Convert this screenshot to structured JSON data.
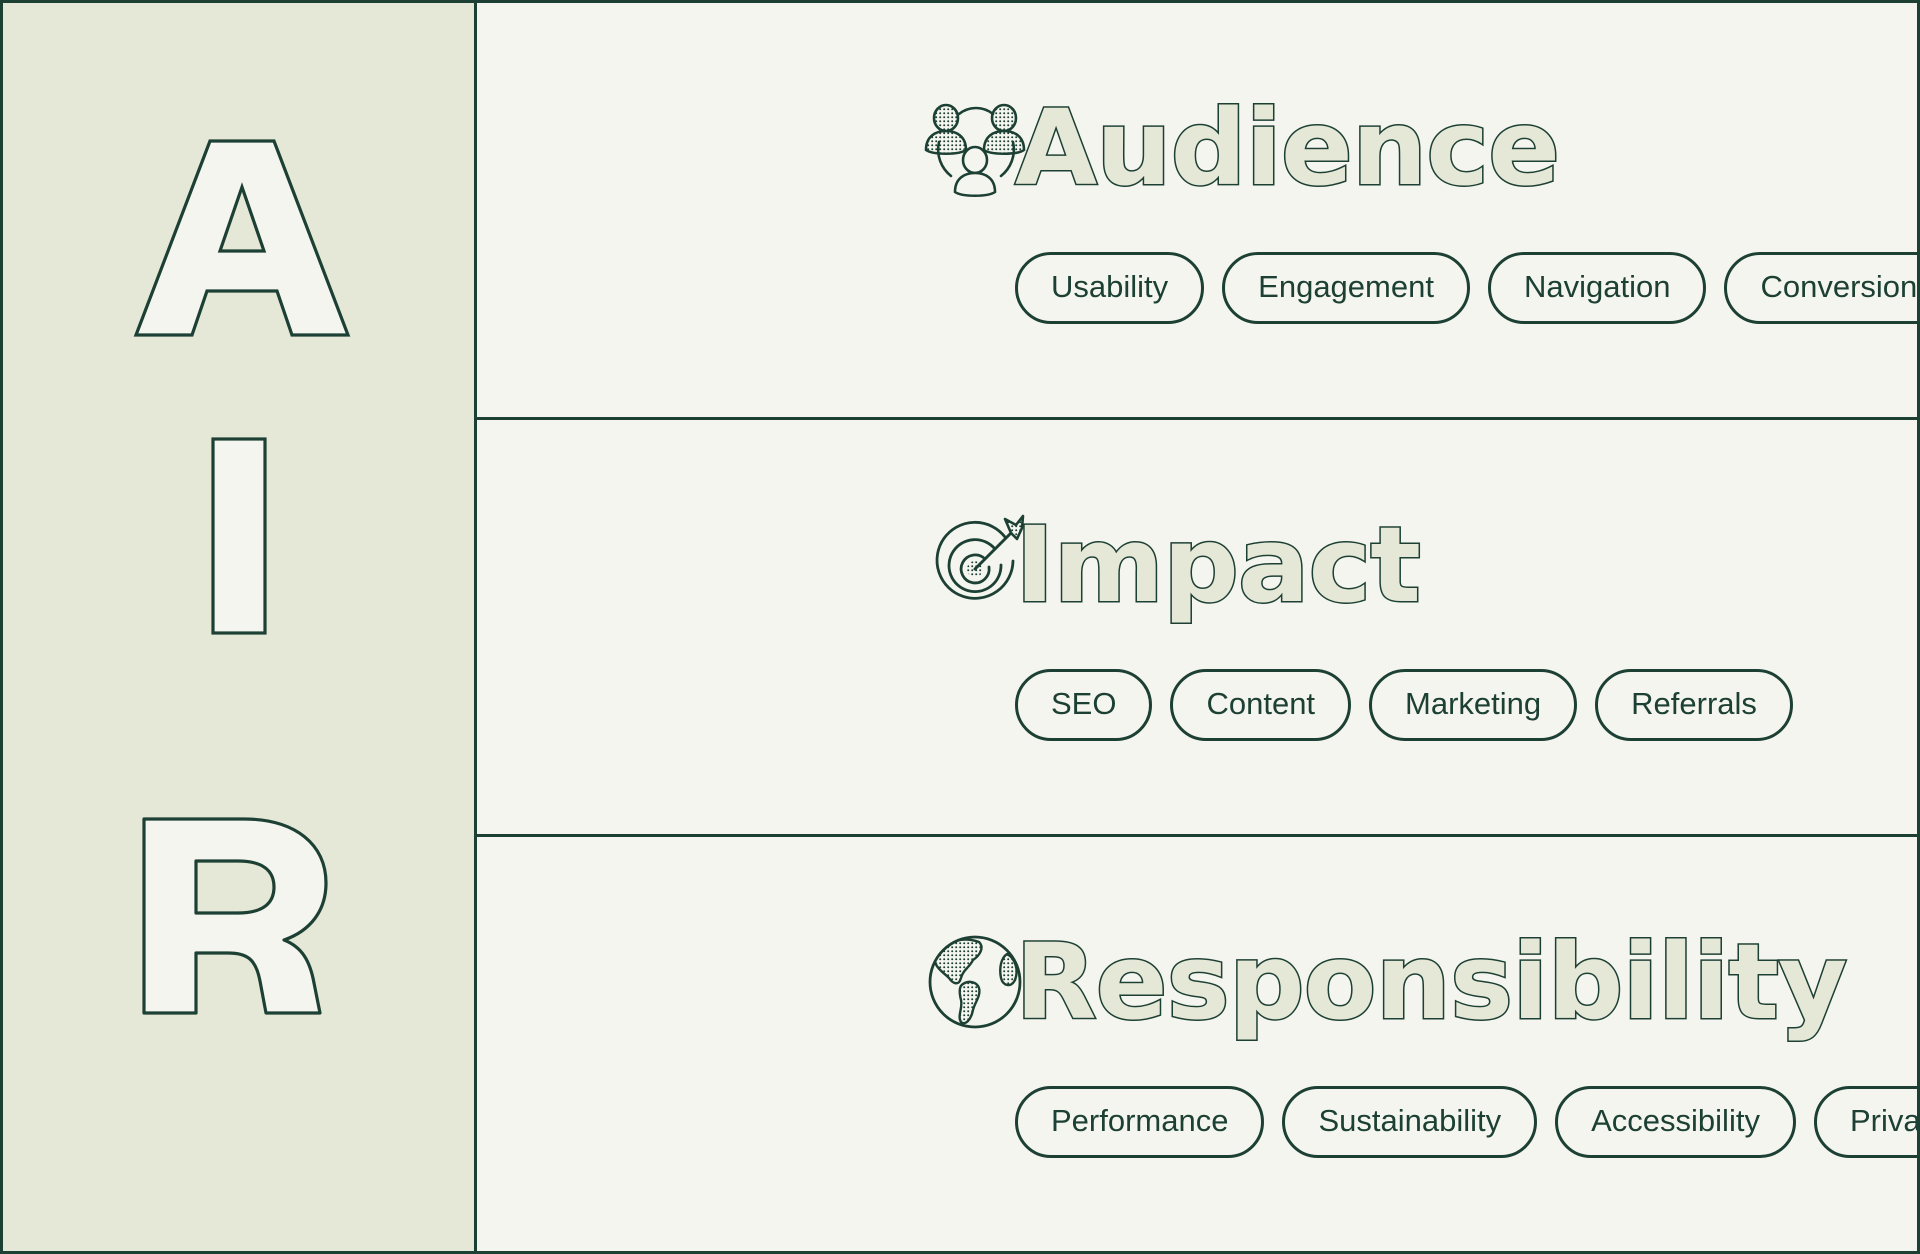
{
  "colors": {
    "sidebar_bg": "#e6e8d7",
    "panel_bg": "#f5f5ef",
    "ink": "#1d4034",
    "letter_fill": "#f5f5ef",
    "title_fill": "#e6e8d7"
  },
  "sidebar": {
    "acronym": "AIR",
    "letters": [
      {
        "label": "A",
        "name": "acronym-letter-a"
      },
      {
        "label": "I",
        "name": "acronym-letter-i"
      },
      {
        "label": "R",
        "name": "acronym-letter-r"
      }
    ]
  },
  "sections": [
    {
      "key": "audience",
      "title": "Audience",
      "icon": "people-network-icon",
      "pills": [
        "Usability",
        "Engagement",
        "Navigation",
        "Conversion"
      ]
    },
    {
      "key": "impact",
      "title": "Impact",
      "icon": "target-dart-icon",
      "pills": [
        "SEO",
        "Content",
        "Marketing",
        "Referrals"
      ]
    },
    {
      "key": "responsibility",
      "title": "Responsibility",
      "icon": "globe-icon",
      "pills": [
        "Performance",
        "Sustainability",
        "Accessibility",
        "Privacy"
      ]
    }
  ]
}
